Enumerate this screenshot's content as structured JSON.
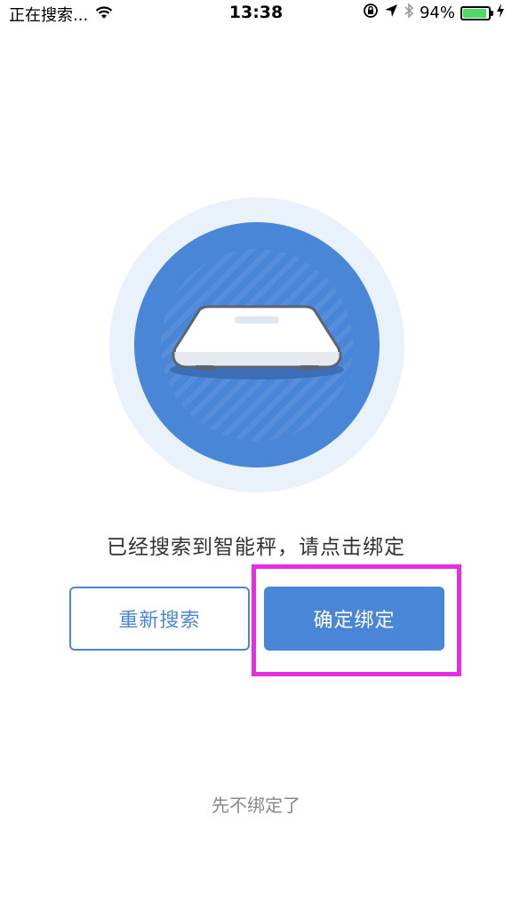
{
  "status_bar": {
    "carrier_text": "正在搜索...",
    "time": "13:38",
    "battery_percent": "94%",
    "icons": [
      "wifi-icon",
      "rotation-lock-icon",
      "location-icon",
      "bluetooth-icon",
      "battery-icon",
      "charging-icon"
    ]
  },
  "illustration": {
    "subject": "smart-scale",
    "colors": {
      "halo": "#e9f1fb",
      "disc": "#4a86d8",
      "scale_body": "#ffffff",
      "scale_shadow": "#3a6fb8"
    }
  },
  "prompt": {
    "text": "已经搜索到智能秤，请点击绑定"
  },
  "buttons": {
    "rescan_label": "重新搜索",
    "confirm_label": "确定绑定"
  },
  "skip": {
    "label": "先不绑定了"
  },
  "colors": {
    "accent": "#4a86d8",
    "highlight": "#e52de3"
  }
}
